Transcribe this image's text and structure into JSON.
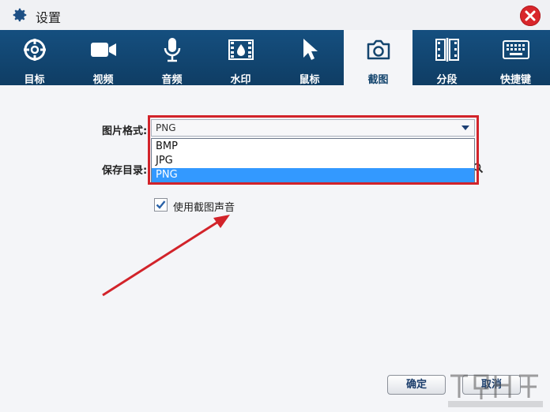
{
  "window": {
    "title": "设置"
  },
  "tabs": [
    {
      "label": "目标",
      "icon": "target-icon"
    },
    {
      "label": "视频",
      "icon": "video-camera-icon"
    },
    {
      "label": "音频",
      "icon": "microphone-icon"
    },
    {
      "label": "水印",
      "icon": "watermark-film-icon"
    },
    {
      "label": "鼠标",
      "icon": "mouse-cursor-icon"
    },
    {
      "label": "截图",
      "icon": "camera-icon",
      "active": true
    },
    {
      "label": "分段",
      "icon": "segment-film-icon"
    },
    {
      "label": "快捷键",
      "icon": "keyboard-icon"
    }
  ],
  "form": {
    "image_format_label": "图片格式:",
    "image_format_value": "PNG",
    "save_dir_label": "保存目录:",
    "format_options": [
      "BMP",
      "JPG",
      "PNG"
    ],
    "selected_option": "PNG",
    "screenshot_sound_label": "使用截图声音",
    "screenshot_sound_checked": true
  },
  "buttons": {
    "ok": "确定",
    "cancel": "取消"
  },
  "colors": {
    "toolbar": "#134a78",
    "highlight": "#d2232a",
    "close": "#d9262b",
    "selection": "#3399ff"
  }
}
